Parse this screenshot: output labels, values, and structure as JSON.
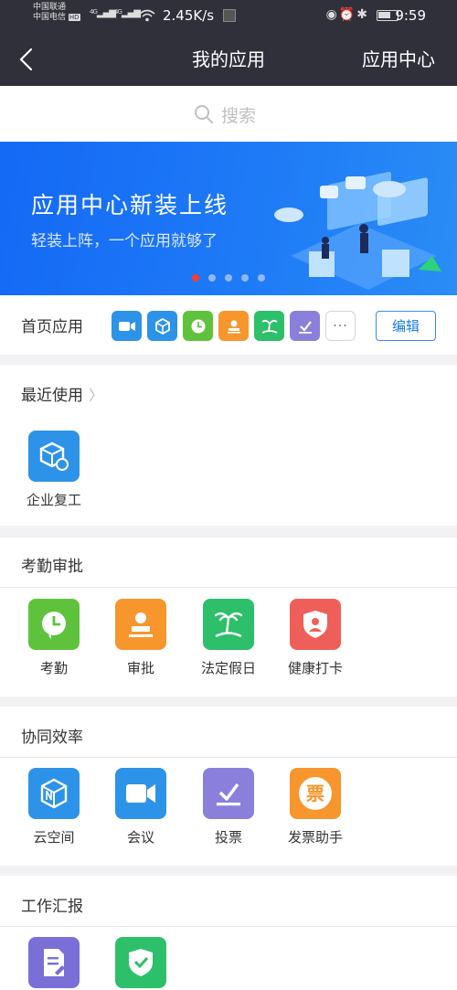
{
  "status_bar": {
    "carrier1": "中国联通",
    "carrier2": "中国电信",
    "hd": "HD",
    "net1": "4G",
    "net2": "4G",
    "speed": "2.45K/s",
    "time": "9:59"
  },
  "nav": {
    "title": "我的应用",
    "right": "应用中心"
  },
  "search": {
    "placeholder": "搜索"
  },
  "banner": {
    "title": "应用中心新装上线",
    "subtitle": "轻装上阵，一个应用就够了",
    "dots_total": 5,
    "active_dot": 1
  },
  "home_apps": {
    "label": "首页应用",
    "edit_label": "编辑",
    "more": "···",
    "icons": [
      "meeting-icon",
      "cloud-space-icon",
      "attendance-icon",
      "approval-icon",
      "holiday-icon",
      "vote-icon"
    ]
  },
  "recent": {
    "title": "最近使用",
    "apps": [
      {
        "label": "企业复工",
        "icon": "enterprise-resume-icon"
      }
    ]
  },
  "attendance": {
    "title": "考勤审批",
    "apps": [
      {
        "label": "考勤",
        "icon": "attendance-icon"
      },
      {
        "label": "审批",
        "icon": "approval-icon"
      },
      {
        "label": "法定假日",
        "icon": "holiday-icon"
      },
      {
        "label": "健康打卡",
        "icon": "health-checkin-icon"
      }
    ]
  },
  "collab": {
    "title": "协同效率",
    "apps": [
      {
        "label": "云空间",
        "icon": "cloud-space-icon"
      },
      {
        "label": "会议",
        "icon": "meeting-icon"
      },
      {
        "label": "投票",
        "icon": "vote-icon"
      },
      {
        "label": "发票助手",
        "icon": "invoice-icon",
        "glyph": "票"
      }
    ]
  },
  "report": {
    "title": "工作汇报",
    "apps": [
      {
        "icon": "report-doc-icon"
      },
      {
        "icon": "check-shield-icon"
      }
    ]
  },
  "colors": {
    "topbar": "#2f3039",
    "banner": "#1a6ff5",
    "green": "#5fc23c",
    "orange": "#f6962c",
    "teal_green": "#2dbf6a",
    "red": "#ef5f59",
    "blue": "#2d93e8",
    "purple": "#8a80dc",
    "edit_border": "#3a8ee6"
  }
}
